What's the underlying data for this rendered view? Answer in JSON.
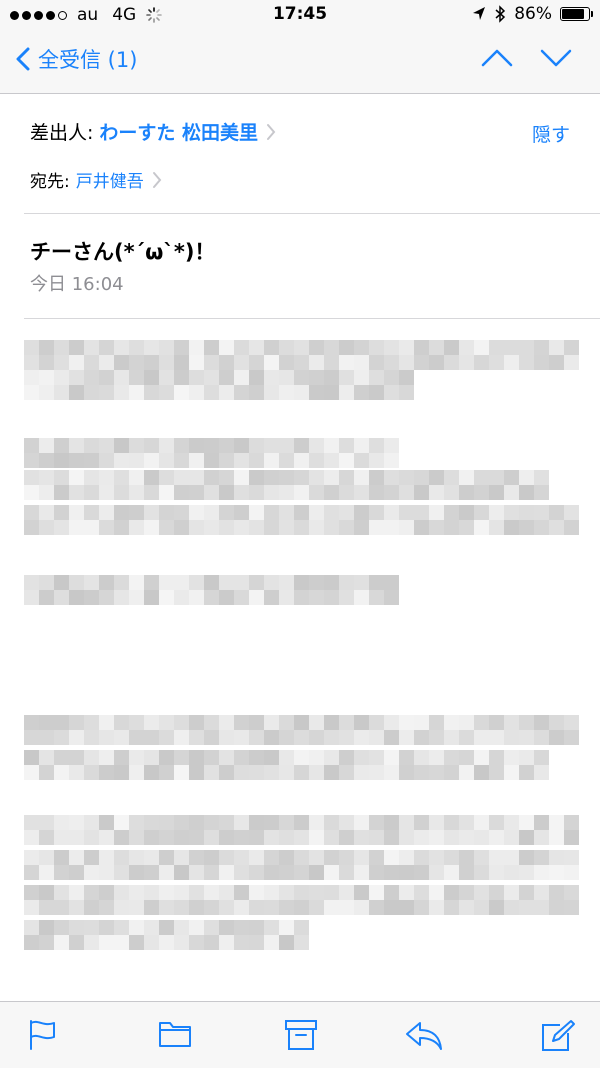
{
  "status_bar": {
    "carrier": "au",
    "network": "4G",
    "time": "17:45",
    "battery_percent_text": "86%",
    "battery_level": 0.86
  },
  "nav": {
    "back_label": "全受信 (1)"
  },
  "header": {
    "from_label": "差出人:",
    "from_name": "わーすた 松田美里",
    "hide_label": "隠す",
    "to_label": "宛先:",
    "to_name": "戸井健吾"
  },
  "message": {
    "subject": "チーさん(*´ω`*)！",
    "date": "今日 16:04"
  },
  "colors": {
    "accent": "#1a82fb",
    "secondary_text": "#8e8e93"
  },
  "toolbar": {
    "icons": [
      "flag-icon",
      "folder-icon",
      "archive-icon",
      "reply-icon",
      "compose-icon"
    ]
  }
}
